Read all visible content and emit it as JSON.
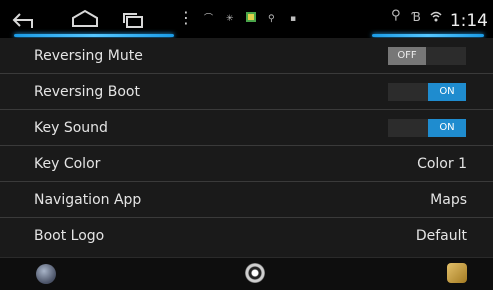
{
  "status_bar": {
    "time": "1:14",
    "icons": [
      "back-icon",
      "home-icon",
      "recent-apps-icon",
      "menu-icon",
      "usb-icon",
      "notification-icon",
      "image-icon",
      "usb-icon",
      "notification-icon",
      "location-icon",
      "bluetooth-icon",
      "wifi-icon"
    ]
  },
  "settings": {
    "rows": [
      {
        "label": "Reversing Mute",
        "type": "toggle",
        "state": "OFF"
      },
      {
        "label": "Reversing Boot",
        "type": "toggle",
        "state": "ON"
      },
      {
        "label": "Key Sound",
        "type": "toggle",
        "state": "ON"
      },
      {
        "label": "Key Color",
        "type": "value",
        "value": "Color 1"
      },
      {
        "label": "Navigation App",
        "type": "value",
        "value": "Maps"
      },
      {
        "label": "Boot Logo",
        "type": "value",
        "value": "Default"
      }
    ]
  },
  "bottom_bar": {
    "icons": [
      "orb-app-icon",
      "center-home-icon",
      "app-tile-icon"
    ]
  },
  "colors": {
    "accent": "#1f8ccf",
    "toggle_off": "#777777",
    "background": "#1a1a1a"
  }
}
